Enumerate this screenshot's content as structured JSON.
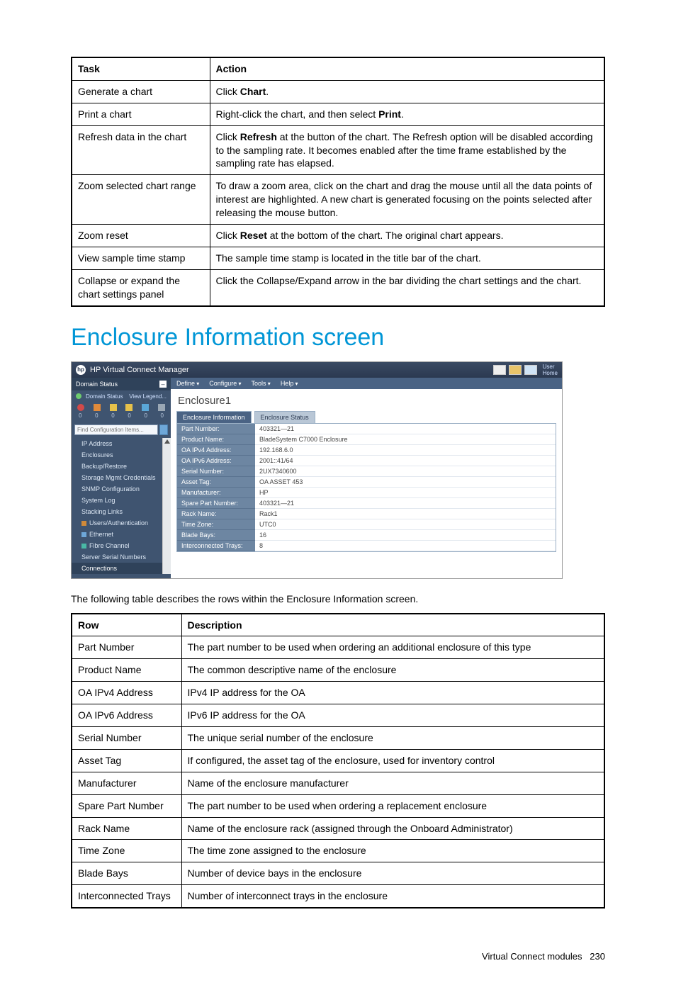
{
  "table1": {
    "headers": [
      "Task",
      "Action"
    ],
    "rows": [
      {
        "task": "Generate a chart",
        "action_parts": [
          {
            "t": "Click "
          },
          {
            "b": "Chart"
          },
          {
            "t": "."
          }
        ]
      },
      {
        "task": "Print a chart",
        "action_parts": [
          {
            "t": "Right-click the chart, and then select "
          },
          {
            "b": "Print"
          },
          {
            "t": "."
          }
        ]
      },
      {
        "task": "Refresh data in the chart",
        "action_parts": [
          {
            "t": "Click "
          },
          {
            "b": "Refresh"
          },
          {
            "t": " at the button of the chart. The Refresh option will be disabled according to the sampling rate. It becomes enabled after the time frame established by the sampling rate has elapsed."
          }
        ]
      },
      {
        "task": "Zoom selected chart range",
        "action_parts": [
          {
            "t": "To draw a zoom area, click on the chart and drag the mouse until all the data points of interest are highlighted. A new chart is generated focusing on the points selected after releasing the mouse button."
          }
        ]
      },
      {
        "task": "Zoom reset",
        "action_parts": [
          {
            "t": "Click "
          },
          {
            "b": "Reset"
          },
          {
            "t": " at the bottom of the chart. The original chart appears."
          }
        ]
      },
      {
        "task": "View sample time stamp",
        "action_parts": [
          {
            "t": "The sample time stamp is located in the title bar of the chart."
          }
        ]
      },
      {
        "task": "Collapse or expand the chart settings panel",
        "action_parts": [
          {
            "t": "Click the Collapse/Expand arrow in the bar dividing the chart settings and the chart."
          }
        ]
      }
    ]
  },
  "heading": "Enclosure Information screen",
  "intro": "The following table describes the rows within the Enclosure Information screen.",
  "table2": {
    "headers": [
      "Row",
      "Description"
    ],
    "rows": [
      [
        "Part Number",
        "The part number to be used when ordering an additional enclosure of this type"
      ],
      [
        "Product Name",
        "The common descriptive name of the enclosure"
      ],
      [
        "OA IPv4 Address",
        "IPv4 IP address for the OA"
      ],
      [
        "OA IPv6 Address",
        "IPv6 IP address for the OA"
      ],
      [
        "Serial Number",
        "The unique serial number of the enclosure"
      ],
      [
        "Asset Tag",
        "If configured, the asset tag of the enclosure, used for inventory control"
      ],
      [
        "Manufacturer",
        "Name of the enclosure manufacturer"
      ],
      [
        "Spare Part Number",
        "The part number to be used when ordering a replacement enclosure"
      ],
      [
        "Rack Name",
        "Name of the enclosure rack (assigned through the Onboard Administrator)"
      ],
      [
        "Time Zone",
        "The time zone assigned to the enclosure"
      ],
      [
        "Blade Bays",
        "Number of device bays in the enclosure"
      ],
      [
        "Interconnected Trays",
        "Number of interconnect trays in the enclosure"
      ]
    ]
  },
  "footer": {
    "text": "Virtual Connect modules",
    "page": "230"
  },
  "vcm": {
    "app_title": "HP Virtual Connect Manager",
    "user_home_lines": [
      "User",
      "Home"
    ],
    "menubar": [
      "Define",
      "Configure",
      "Tools",
      "Help"
    ],
    "side": {
      "panel_title": "Domain Status",
      "status_links": [
        "Domain Status",
        "View Legend..."
      ],
      "zeros": [
        "0",
        "0",
        "0",
        "0",
        "0",
        "0"
      ],
      "search_placeholder": "Find Configuration Items...",
      "nav": [
        {
          "label": "IP Address",
          "sq": false
        },
        {
          "label": "Enclosures",
          "sq": false
        },
        {
          "label": "Backup/Restore",
          "sq": false
        },
        {
          "label": "Storage Mgmt Credentials",
          "sq": false
        },
        {
          "label": "SNMP Configuration",
          "sq": false
        },
        {
          "label": "System Log",
          "sq": false
        },
        {
          "label": "Stacking Links",
          "sq": false
        },
        {
          "label": "Users/Authentication",
          "sq": true,
          "cls": "sq"
        },
        {
          "label": "Ethernet",
          "sq": true,
          "cls": "sq sq-blue"
        },
        {
          "label": "Fibre Channel",
          "sq": true,
          "cls": "sq sq-teal"
        },
        {
          "label": "Server Serial Numbers",
          "sq": false
        },
        {
          "label": "Connections",
          "sq": false,
          "sel": true
        }
      ]
    },
    "main": {
      "title": "Enclosure1",
      "tabs": [
        {
          "label": "Enclosure Information",
          "active": true
        },
        {
          "label": "Enclosure Status",
          "active": false
        }
      ],
      "info": [
        [
          "Part Number:",
          "403321—21"
        ],
        [
          "Product Name:",
          "BladeSystem C7000 Enclosure"
        ],
        [
          "OA IPv4 Address:",
          "192.168.6.0"
        ],
        [
          "OA IPv6 Address:",
          "2001::41/64"
        ],
        [
          "Serial Number:",
          "2UX7340600"
        ],
        [
          "Asset Tag:",
          "OA ASSET 453"
        ],
        [
          "Manufacturer:",
          "HP"
        ],
        [
          "Spare Part Number:",
          "403321—21"
        ],
        [
          "Rack Name:",
          "Rack1"
        ],
        [
          "Time Zone:",
          "UTC0"
        ],
        [
          "Blade Bays:",
          "16"
        ],
        [
          "Interconnected Trays:",
          "8"
        ]
      ]
    },
    "icon_colors": [
      "#d24a4a",
      "#e08a3a",
      "#e6c14a",
      "#e6c14a",
      "#5aa7d8",
      "#9aa7b4"
    ]
  }
}
